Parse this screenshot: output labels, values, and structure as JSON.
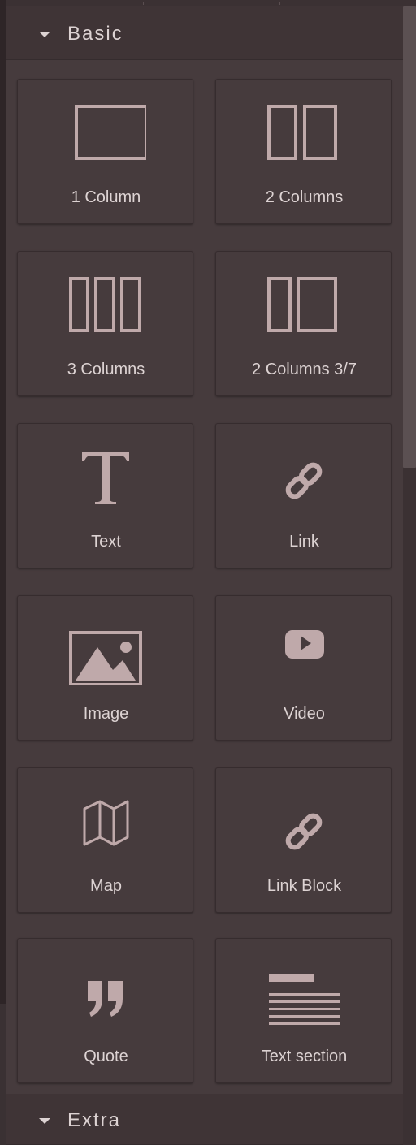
{
  "categories": [
    {
      "label": "Basic"
    },
    {
      "label": "Extra"
    }
  ],
  "blocks": [
    {
      "label": "1 Column",
      "icon": "one-column-icon"
    },
    {
      "label": "2 Columns",
      "icon": "two-columns-icon"
    },
    {
      "label": "3 Columns",
      "icon": "three-columns-icon"
    },
    {
      "label": "2 Columns 3/7",
      "icon": "two-columns-3-7-icon"
    },
    {
      "label": "Text",
      "icon": "text-icon"
    },
    {
      "label": "Link",
      "icon": "link-icon"
    },
    {
      "label": "Image",
      "icon": "image-icon"
    },
    {
      "label": "Video",
      "icon": "video-icon"
    },
    {
      "label": "Map",
      "icon": "map-icon"
    },
    {
      "label": "Link Block",
      "icon": "link-block-icon"
    },
    {
      "label": "Quote",
      "icon": "quote-icon"
    },
    {
      "label": "Text section",
      "icon": "text-section-icon"
    }
  ],
  "colors": {
    "panel": "#463b3d",
    "header": "#3f3436",
    "text": "#ddd3d3",
    "icon": "#bfa9aa"
  }
}
